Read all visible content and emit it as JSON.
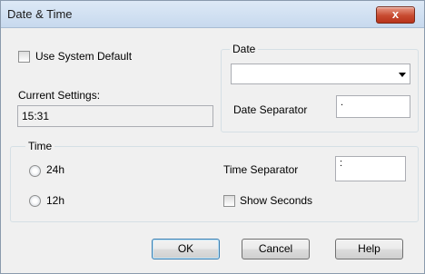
{
  "window": {
    "title": "Date & Time",
    "close_glyph": "x"
  },
  "general": {
    "use_system_default_label": "Use System Default",
    "use_system_default_checked": false,
    "current_settings_label": "Current Settings:",
    "current_settings_value": "15:31"
  },
  "date_group": {
    "caption": "Date",
    "format_value": "",
    "separator_label": "Date Separator",
    "separator_value": "."
  },
  "time_group": {
    "caption": "Time",
    "radio_24h_label": "24h",
    "radio_12h_label": "12h",
    "separator_label": "Time Separator",
    "separator_value": ":",
    "show_seconds_label": "Show Seconds",
    "show_seconds_checked": false
  },
  "buttons": {
    "ok": "OK",
    "cancel": "Cancel",
    "help": "Help"
  }
}
